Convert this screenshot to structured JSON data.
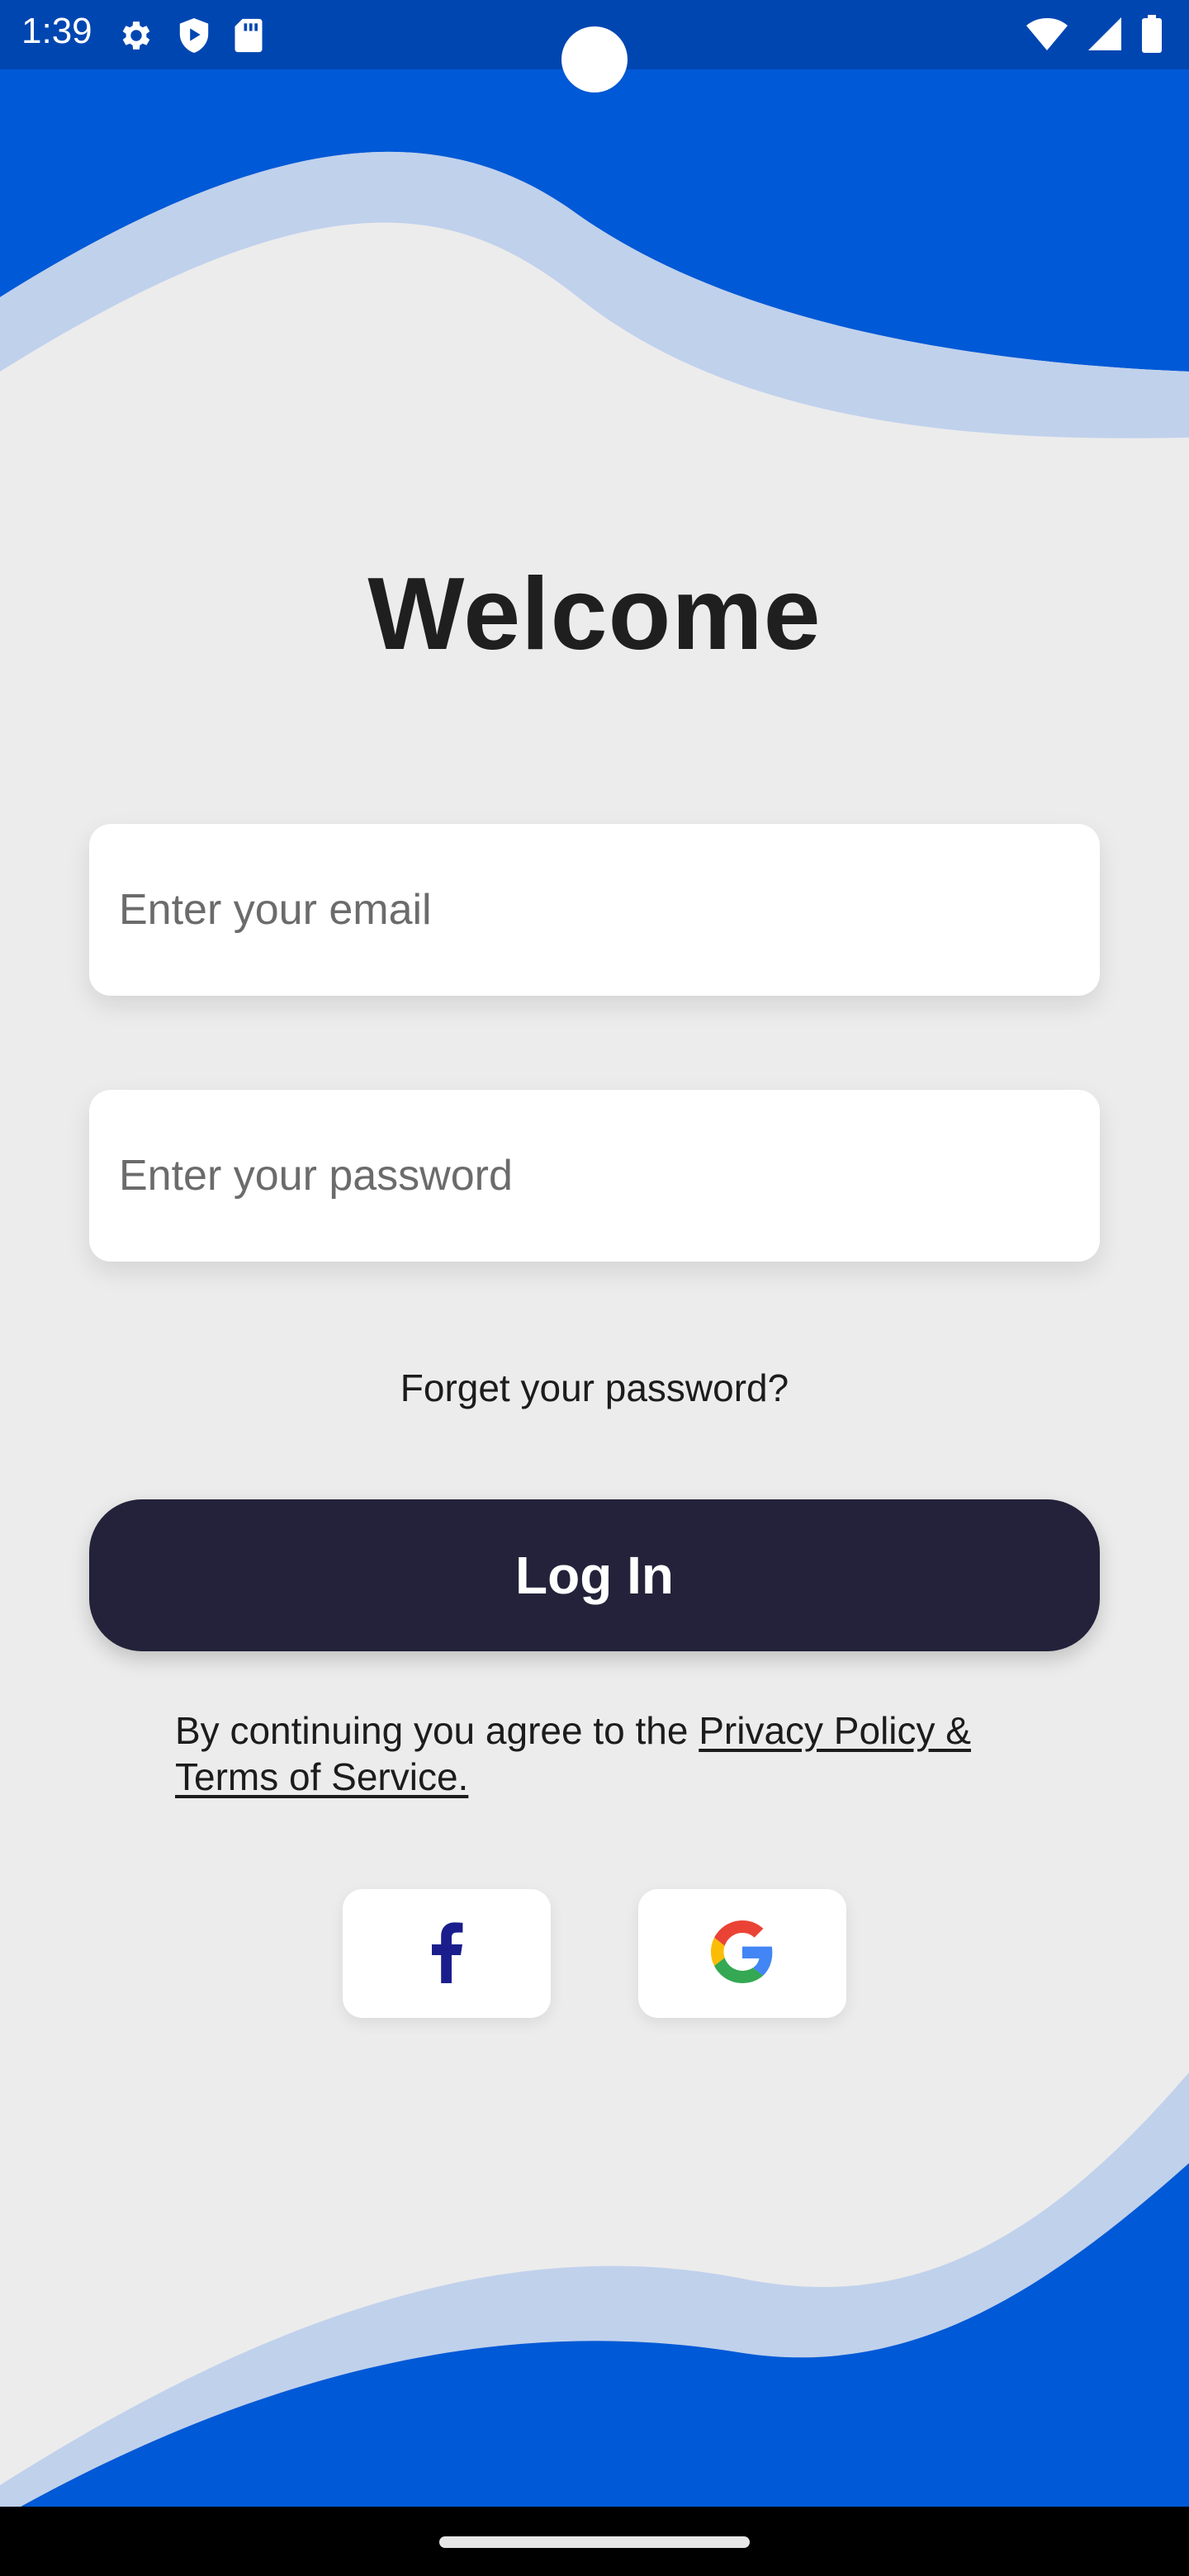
{
  "status_bar": {
    "time": "1:39",
    "left_icons": [
      "gear-icon",
      "shield-play-icon",
      "sd-card-icon"
    ],
    "right_icons": [
      "wifi-icon",
      "signal-icon",
      "battery-icon"
    ]
  },
  "login": {
    "title": "Welcome",
    "email_placeholder": "Enter your email",
    "password_placeholder": "Enter your password",
    "forgot_label": "Forget your password?",
    "login_label": "Log In",
    "terms_prefix": "By continuing you agree to the ",
    "terms_link": "Privacy Policy & Terms of Service."
  },
  "social": {
    "facebook_icon": "facebook-icon",
    "google_icon": "google-icon"
  },
  "colors": {
    "primary_blue": "#0059d6",
    "status_bar": "#0046b1",
    "wave_light": "#c0d1ec",
    "background": "#ececec",
    "button": "#23223a",
    "facebook": "#1a1e8c"
  }
}
